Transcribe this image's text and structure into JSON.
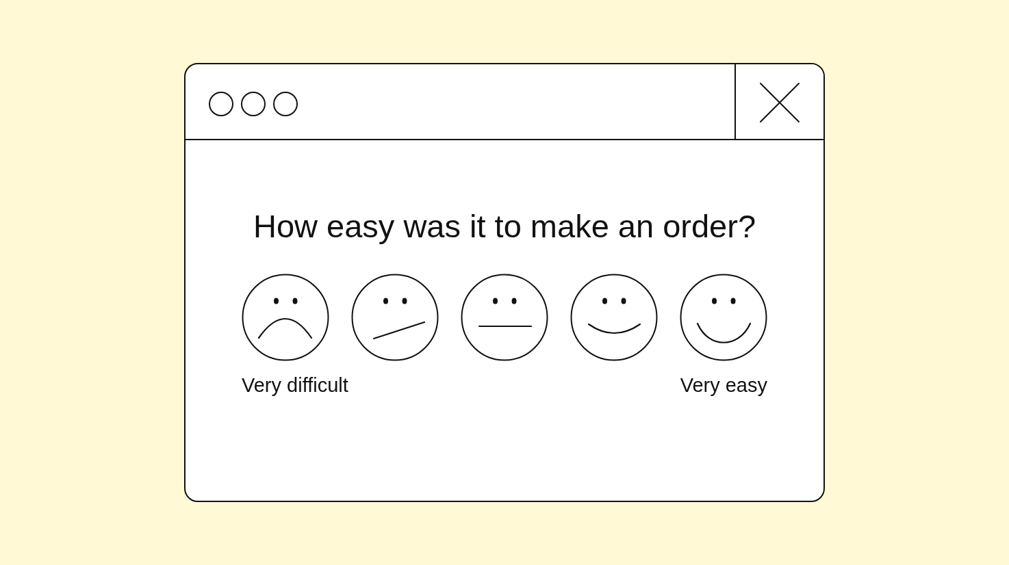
{
  "question": "How easy was it to make an order?",
  "faces": [
    {
      "kind": "frown",
      "selected": false
    },
    {
      "kind": "smirk",
      "selected": false
    },
    {
      "kind": "neutral",
      "selected": false
    },
    {
      "kind": "smile",
      "selected": false
    },
    {
      "kind": "grin",
      "selected": false
    }
  ],
  "scale_labels": {
    "low": "Very difficult",
    "high": "Very easy"
  }
}
